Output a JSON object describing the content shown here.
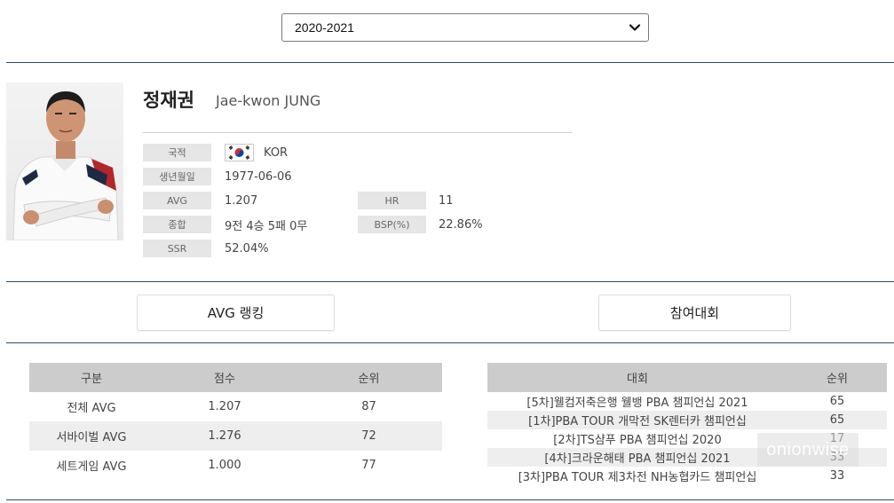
{
  "season_select": {
    "value": "2020-2021"
  },
  "player": {
    "name_ko": "정재권",
    "name_en": "Jae-kwon JUNG",
    "fields": {
      "nationality_label": "국적",
      "nationality_value": "KOR",
      "birth_label": "생년월일",
      "birth_value": "1977-06-06",
      "avg_label": "AVG",
      "avg_value": "1.207",
      "hr_label": "HR",
      "hr_value": "11",
      "record_label": "종합",
      "record_value": "9전 4승 5패 0무",
      "bsp_label": "BSP(%)",
      "bsp_value": "22.86%",
      "ssr_label": "SSR",
      "ssr_value": "52.04%"
    }
  },
  "tabs": {
    "avg_ranking": "AVG 랭킹",
    "tournaments": "참여대회"
  },
  "rank_table": {
    "headers": [
      "구분",
      "점수",
      "순위"
    ],
    "rows": [
      [
        "전체 AVG",
        "1.207",
        "87"
      ],
      [
        "서바이벌 AVG",
        "1.276",
        "72"
      ],
      [
        "세트게임 AVG",
        "1.000",
        "77"
      ]
    ]
  },
  "tour_table": {
    "headers": [
      "대회",
      "순위"
    ],
    "rows": [
      [
        "[5차]웰컴저축은행 웰뱅 PBA 챔피언십 2021",
        "65"
      ],
      [
        "[1차]PBA TOUR 개막전 SK렌터카 챔피언십",
        "65"
      ],
      [
        "[2차]TS샴푸 PBA 챔피언십 2020",
        "17"
      ],
      [
        "[4차]크라운해태 PBA 챔피언십 2021",
        "33"
      ],
      [
        "[3차]PBA TOUR 제3차전 NH농협카드 챔피언십",
        "33"
      ]
    ]
  },
  "watermark": "onionwise",
  "colors": {
    "rule": "#2f4a63",
    "header_bg": "#cccccc",
    "label_bg": "#e6e6e6",
    "alt_row": "#eeeeee"
  },
  "icons": {
    "dropdown": "chevron-down-icon",
    "flag": "korea-flag-icon"
  }
}
